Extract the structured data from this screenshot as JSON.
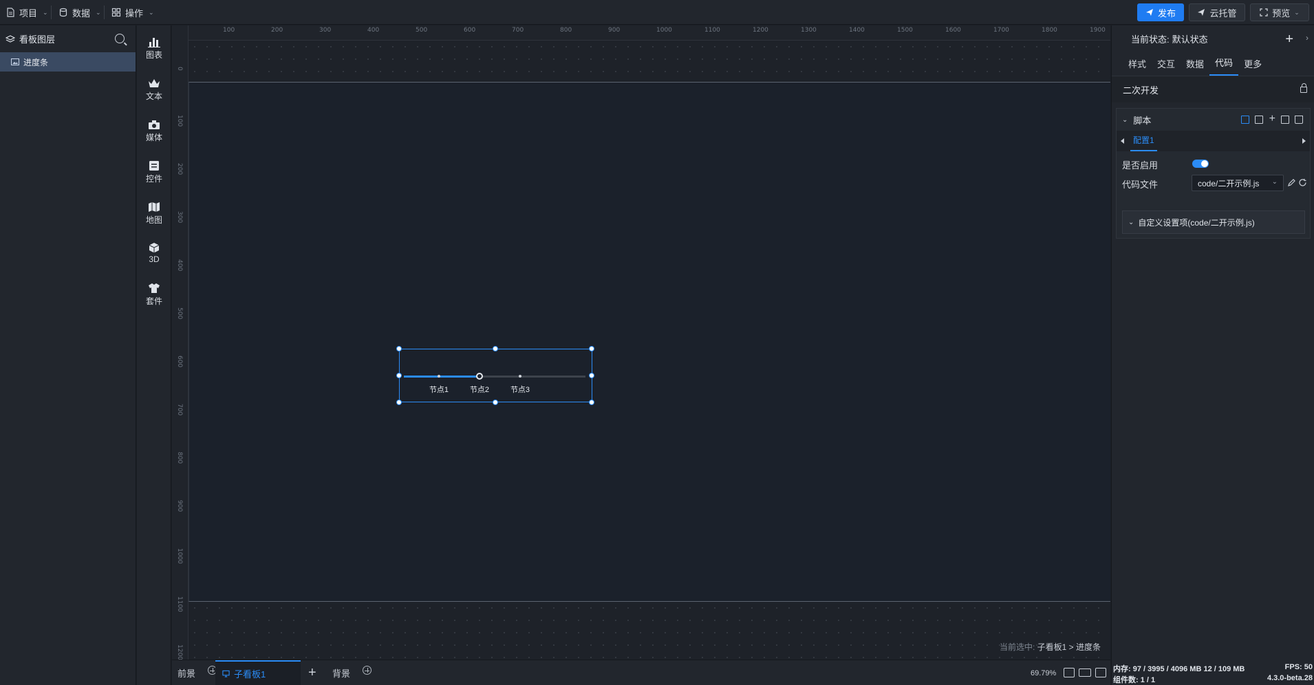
{
  "topbar": {
    "menus": [
      {
        "label": "项目",
        "icon": "document-icon"
      },
      {
        "label": "数据",
        "icon": "database-icon"
      },
      {
        "label": "操作",
        "icon": "grid-icon"
      }
    ],
    "publish_label": "发布",
    "cloud_label": "云托管",
    "preview_label": "预览"
  },
  "layers": {
    "title": "看板图层",
    "items": [
      {
        "label": "进度条",
        "icon": "image-icon"
      }
    ]
  },
  "tools": [
    {
      "label": "图表",
      "icon": "bar-chart-icon"
    },
    {
      "label": "文本",
      "icon": "crown-icon"
    },
    {
      "label": "媒体",
      "icon": "camera-icon"
    },
    {
      "label": "控件",
      "icon": "widget-icon"
    },
    {
      "label": "地图",
      "icon": "map-icon"
    },
    {
      "label": "3D",
      "icon": "cube-icon"
    },
    {
      "label": "套件",
      "icon": "shirt-icon"
    }
  ],
  "rulers": {
    "top": [
      "100",
      "200",
      "300",
      "400",
      "500",
      "600",
      "700",
      "800",
      "900",
      "1000",
      "1100",
      "1200",
      "1300",
      "1400",
      "1500",
      "1600",
      "1700",
      "1800",
      "1900"
    ],
    "left": [
      "0",
      "100",
      "200",
      "300",
      "400",
      "500",
      "600",
      "700",
      "800",
      "900",
      "1000",
      "1100",
      "1200"
    ]
  },
  "progress": {
    "nodes": [
      "节点1",
      "节点2",
      "节点3"
    ],
    "active_index": 1
  },
  "canvas": {
    "selection_prefix": "当前选中:",
    "selection_path": "子看板1 > 进度条"
  },
  "bottombar": {
    "front_label": "前景",
    "subboard_label": "子看板1",
    "background_label": "背景",
    "zoom": "69.79%"
  },
  "rpanel": {
    "state_label": "当前状态:",
    "state_value": "默认状态",
    "tabs": [
      "样式",
      "交互",
      "数据",
      "代码",
      "更多"
    ],
    "active_tab": "代码",
    "section_title": "二次开发",
    "script_title": "脚本",
    "config_tab": "配置1",
    "enable_label": "是否启用",
    "enabled": true,
    "code_file_label": "代码文件",
    "code_file_value": "code/二开示例.js",
    "custom_settings_label": "自定义设置项(code/二开示例.js)"
  },
  "status": {
    "memory": "内存: 97 / 3995 / 4096 MB 12 / 109 MB",
    "fps": "FPS: 50",
    "components": "组件数: 1 / 1",
    "version": "4.3.0-beta.28"
  },
  "colors": {
    "accent": "#1f7cf2",
    "panel": "#22262d",
    "canvas": "#1b212b"
  }
}
